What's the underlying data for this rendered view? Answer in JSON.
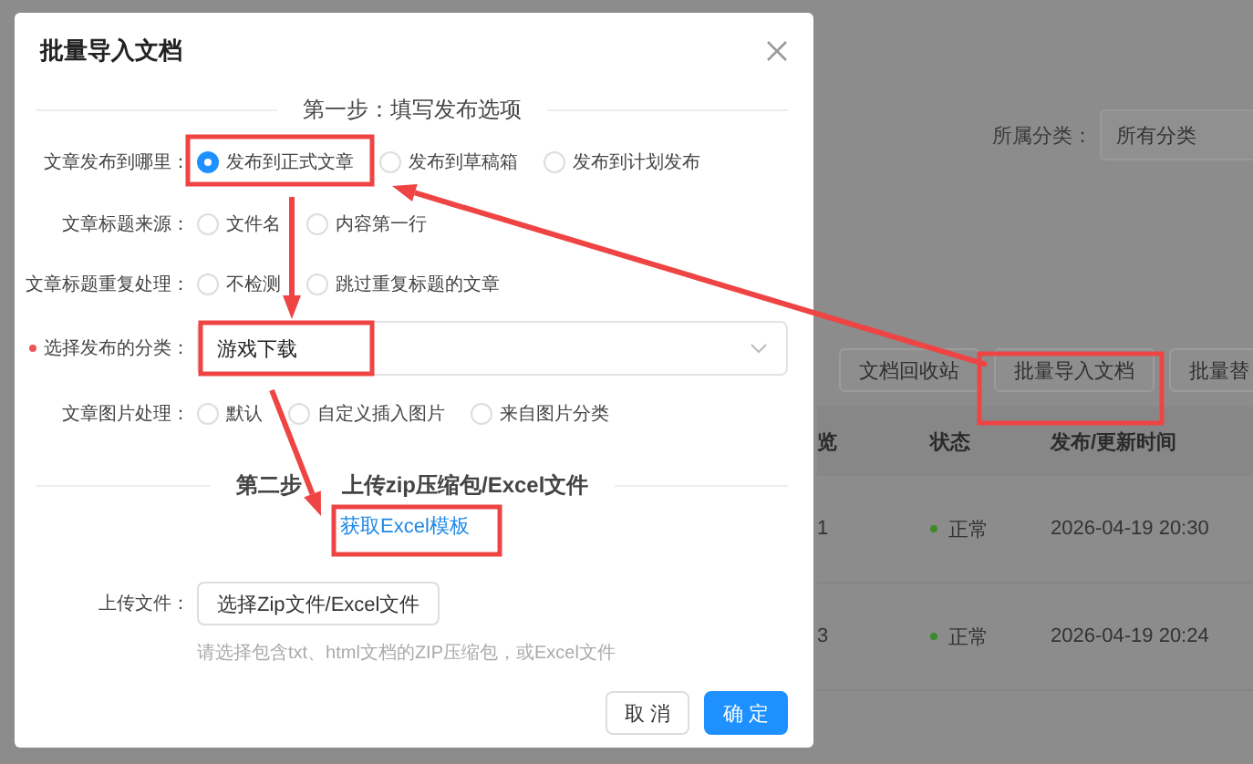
{
  "background": {
    "filter": {
      "label": "所属分类：",
      "value": "所有分类"
    },
    "toolbar": [
      "文档回收站",
      "批量导入文档",
      "批量替"
    ],
    "table": {
      "columns": [
        "览",
        "状态",
        "发布/更新时间"
      ],
      "rows": [
        {
          "column_1": "1",
          "status": "正常",
          "time": "2026-04-19 20:30"
        },
        {
          "column_1": "3",
          "status": "正常",
          "time": "2026-04-19 20:24"
        }
      ]
    }
  },
  "dialog": {
    "title": "批量导入文档",
    "step1": "第一步：填写发布选项",
    "options": [
      {
        "kind": "radio",
        "label": "文章发布到哪里：",
        "required": false,
        "choices": [
          {
            "label": "发布到正式文章",
            "selected": true
          },
          {
            "label": "发布到草稿箱",
            "selected": false
          },
          {
            "label": "发布到计划发布",
            "selected": false
          }
        ]
      },
      {
        "kind": "radio",
        "label": "文章标题来源：",
        "required": false,
        "choices": [
          {
            "label": "文件名",
            "selected": false
          },
          {
            "label": "内容第一行",
            "selected": false
          }
        ]
      },
      {
        "kind": "radio",
        "label": "文章标题重复处理：",
        "required": false,
        "choices": [
          {
            "label": "不检测",
            "selected": false
          },
          {
            "label": "跳过重复标题的文章",
            "selected": false
          }
        ]
      },
      {
        "kind": "select",
        "label": "选择发布的分类：",
        "required": true,
        "value": "游戏下载"
      },
      {
        "kind": "radio",
        "label": "文章图片处理：",
        "required": false,
        "choices": [
          {
            "label": "默认",
            "selected": false
          },
          {
            "label": "自定义插入图片",
            "selected": false
          },
          {
            "label": "来自图片分类",
            "selected": false
          }
        ]
      }
    ],
    "step2": [
      "第二步",
      "上传zip压缩包/Excel文件"
    ],
    "template_link": "获取Excel模板",
    "upload": {
      "label": "上传文件：",
      "button": "选择Zip文件/Excel文件",
      "hint": "请选择包含txt、html文档的ZIP压缩包，或Excel文件"
    },
    "buttons": [
      {
        "kind": "secondary",
        "label": "取 消"
      },
      {
        "kind": "primary",
        "label": "确 定"
      }
    ]
  }
}
